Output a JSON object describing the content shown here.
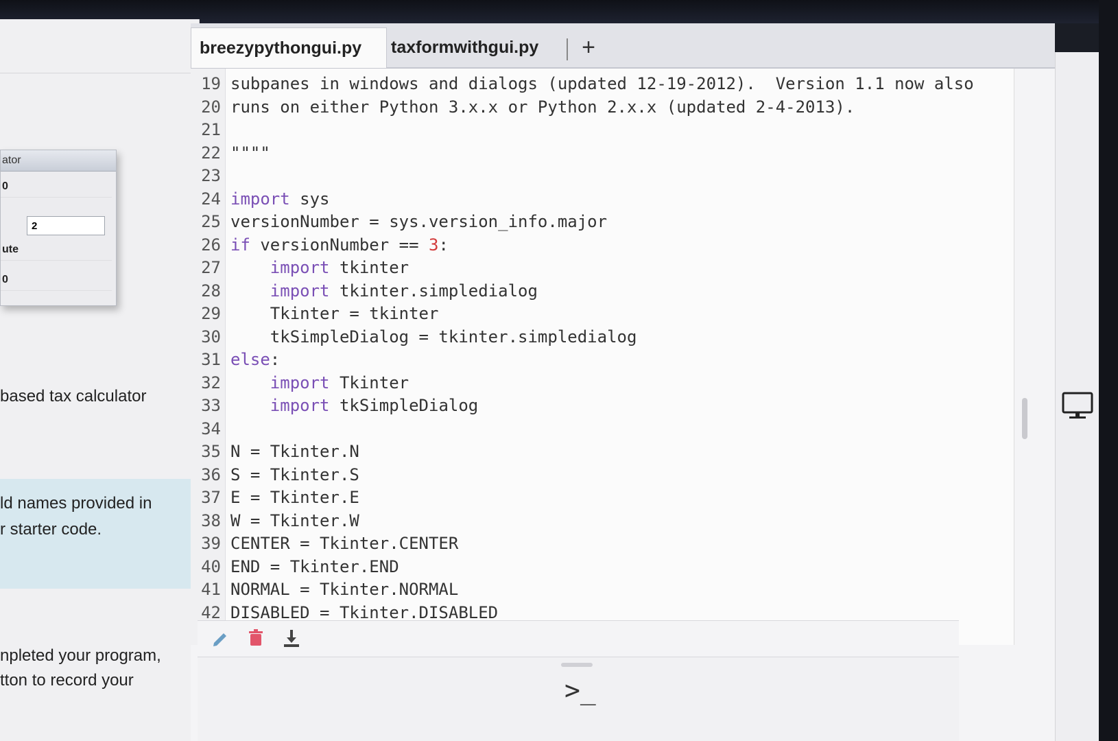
{
  "left_panel": {
    "mini_window": {
      "title": "ator",
      "rows": [
        "0",
        "ute",
        "0"
      ],
      "input_value": "2"
    },
    "text_1": "based tax calculator",
    "text_2a": "ld names provided in",
    "text_2b": "r starter code.",
    "text_3a": "npleted your program,",
    "text_3b": "tton to record your"
  },
  "tabs": [
    {
      "label": "breezypythongui.py",
      "active": true
    },
    {
      "label": "taxformwithgui.py",
      "active": false
    }
  ],
  "add_tab_label": "+",
  "code_lines": [
    {
      "n": "19",
      "text": "subpanes in windows and dialogs (updated 12-19-2012).  Version 1.1 now also"
    },
    {
      "n": "20",
      "text": "runs on either Python 3.x.x or Python 2.x.x (updated 2-4-2013)."
    },
    {
      "n": "21",
      "text": ""
    },
    {
      "n": "22",
      "text": "\"\"\"\""
    },
    {
      "n": "23",
      "text": ""
    },
    {
      "n": "24",
      "kw": "import",
      "text": " sys"
    },
    {
      "n": "25",
      "text": "versionNumber = sys.version_info.major"
    },
    {
      "n": "26",
      "kw": "if",
      "text": " versionNumber == ",
      "num": "3",
      "tail": ":"
    },
    {
      "n": "27",
      "indent": "    ",
      "kw": "import",
      "text": " tkinter"
    },
    {
      "n": "28",
      "indent": "    ",
      "kw": "import",
      "text": " tkinter.simpledialog"
    },
    {
      "n": "29",
      "indent": "    ",
      "text": "Tkinter = tkinter"
    },
    {
      "n": "30",
      "indent": "    ",
      "text": "tkSimpleDialog = tkinter.simpledialog"
    },
    {
      "n": "31",
      "kw": "else",
      "text": ":"
    },
    {
      "n": "32",
      "indent": "    ",
      "kw": "import",
      "text": " Tkinter"
    },
    {
      "n": "33",
      "indent": "    ",
      "kw": "import",
      "text": " tkSimpleDialog"
    },
    {
      "n": "34",
      "text": ""
    },
    {
      "n": "35",
      "text": "N = Tkinter.N"
    },
    {
      "n": "36",
      "text": "S = Tkinter.S"
    },
    {
      "n": "37",
      "text": "E = Tkinter.E"
    },
    {
      "n": "38",
      "text": "W = Tkinter.W"
    },
    {
      "n": "39",
      "text": "CENTER = Tkinter.CENTER"
    },
    {
      "n": "40",
      "text": "END = Tkinter.END"
    },
    {
      "n": "41",
      "text": "NORMAL = Tkinter.NORMAL"
    },
    {
      "n": "42",
      "text": "DISABLED = Tkinter.DISABLED"
    }
  ],
  "toolbar": {
    "edit_icon": "pencil-icon",
    "delete_icon": "trash-icon",
    "download_icon": "download-icon",
    "edit_color": "#6a9ec4",
    "delete_color": "#e2556a",
    "download_color": "#444444"
  },
  "console": {
    "prompt": ">_"
  },
  "right_panel": {
    "icon": "desktop-icon"
  }
}
